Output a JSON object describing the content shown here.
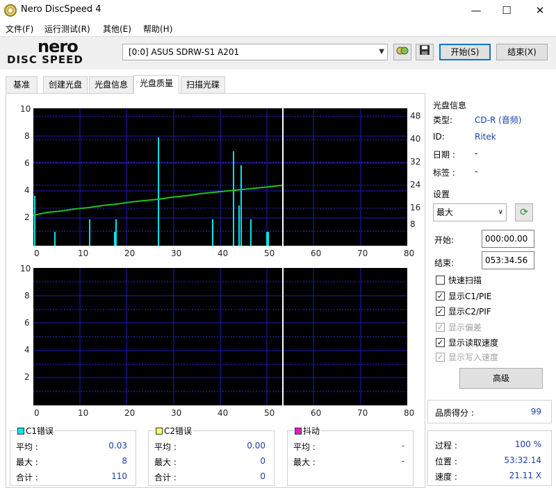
{
  "window": {
    "title": "Nero DiscSpeed 4",
    "min": "—",
    "max": "☐",
    "close": "✕"
  },
  "menu": [
    "文件(F)",
    "运行测试(R)",
    "其他(E)",
    "帮助(H)"
  ],
  "logo": {
    "top": "nero",
    "bottom": "DISC SPEED"
  },
  "toolbar": {
    "drive": "[0:0]   ASUS SDRW-S1 A201",
    "start": "开始(S)",
    "exit": "结束(X)"
  },
  "tabs": [
    "基准",
    "创建光盘",
    "光盘信息",
    "光盘质量",
    "扫描光碟"
  ],
  "charts": {
    "top": {
      "y_left": [
        "10",
        "8",
        "6",
        "4",
        "2"
      ],
      "y_right": [
        "48",
        "40",
        "32",
        "24",
        "16",
        "8"
      ],
      "x": [
        "0",
        "10",
        "20",
        "30",
        "40",
        "50",
        "60",
        "70",
        "80"
      ]
    },
    "bottom": {
      "y_left": [
        "10",
        "8",
        "6",
        "4",
        "2"
      ],
      "x": [
        "0",
        "10",
        "20",
        "30",
        "40",
        "50",
        "60",
        "70",
        "80"
      ]
    }
  },
  "disc_info": {
    "title": "光盘信息",
    "rows": [
      {
        "label": "类型:",
        "value": "CD-R (音频)"
      },
      {
        "label": "ID:",
        "value": "Ritek"
      },
      {
        "label": "日期 :",
        "value": "-"
      },
      {
        "label": "标签 :",
        "value": "-"
      }
    ]
  },
  "settings": {
    "title": "设置",
    "speed": "最大",
    "start_label": "开始:",
    "start_value": "000:00.00",
    "end_label": "结束:",
    "end_value": "053:34.56",
    "checks": [
      {
        "label": "快速扫描",
        "checked": false,
        "disabled": false
      },
      {
        "label": "显示C1/PIE",
        "checked": true,
        "disabled": false
      },
      {
        "label": "显示C2/PIF",
        "checked": true,
        "disabled": false
      },
      {
        "label": "显示偏差",
        "checked": true,
        "disabled": true
      },
      {
        "label": "显示读取速度",
        "checked": true,
        "disabled": false
      },
      {
        "label": "显示写入速度",
        "checked": true,
        "disabled": true
      }
    ],
    "advanced": "高级"
  },
  "quality": {
    "label": "品质得分 :",
    "value": "99"
  },
  "progress": {
    "rows": [
      {
        "label": "过程 :",
        "value": "100 %"
      },
      {
        "label": "位置 :",
        "value": "53:32.14"
      },
      {
        "label": "速度 :",
        "value": "21.11 X"
      }
    ]
  },
  "stats": [
    {
      "title": "C1错误",
      "color": "#00e5ee",
      "rows": [
        {
          "label": "平均 :",
          "value": "0.03"
        },
        {
          "label": "最大 :",
          "value": "8"
        },
        {
          "label": "合计 :",
          "value": "110"
        }
      ]
    },
    {
      "title": "C2错误",
      "color": "#ffff66",
      "rows": [
        {
          "label": "平均 :",
          "value": "0.00"
        },
        {
          "label": "最大 :",
          "value": "0"
        },
        {
          "label": "合计 :",
          "value": "0"
        }
      ]
    },
    {
      "title": "抖动",
      "color": "#e020c0",
      "rows": [
        {
          "label": "平均 :",
          "value": "-"
        },
        {
          "label": "最大 :",
          "value": "-"
        }
      ]
    }
  ],
  "colors": {
    "c1": "#00e5ee",
    "speed": "#22c022",
    "grid": "#1c1cc8",
    "bg": "#000000",
    "marker": "#ffffff"
  }
}
